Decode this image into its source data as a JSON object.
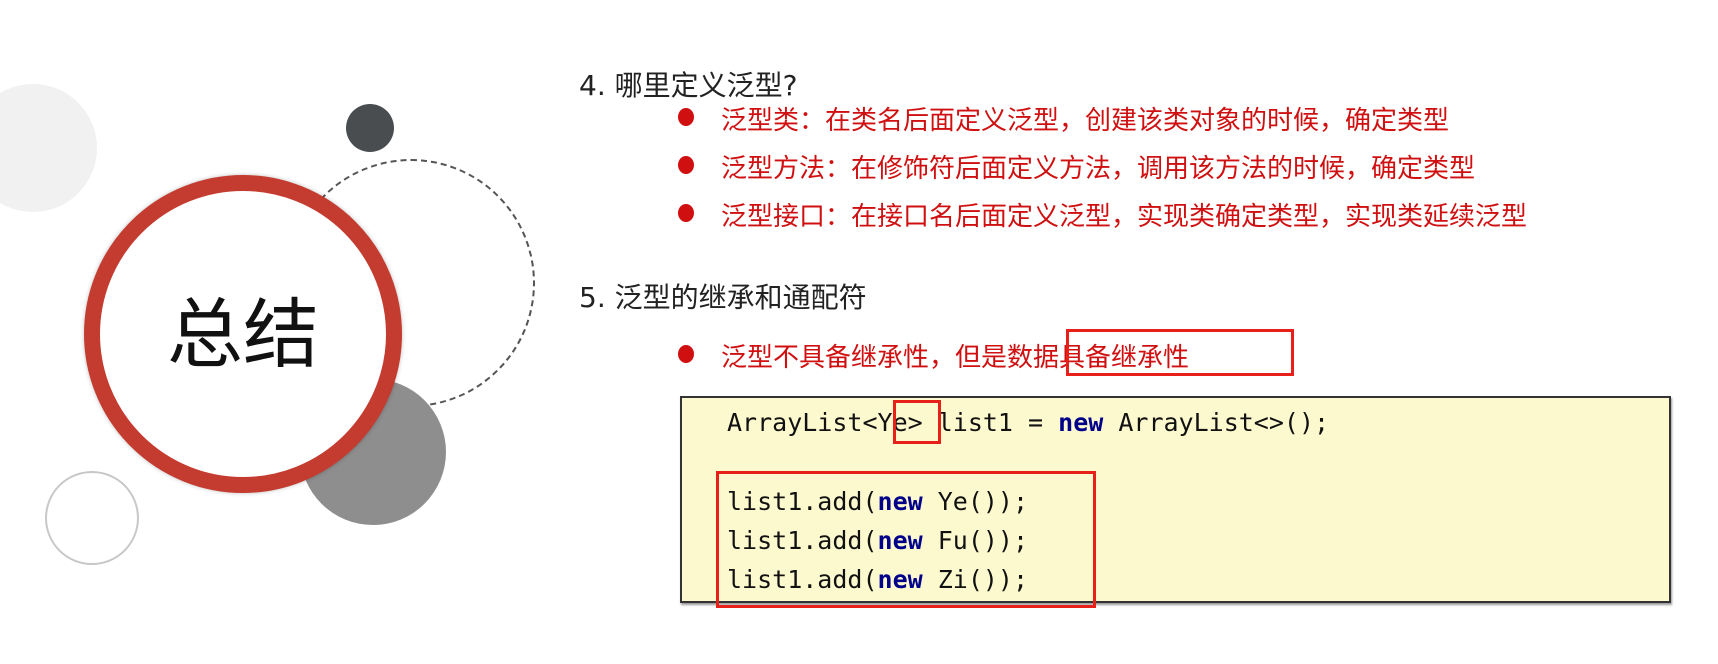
{
  "decor": {
    "title": "总结",
    "accent": "#c43b2f"
  },
  "section4": {
    "heading": "4.  哪里定义泛型?",
    "bullets": [
      "泛型类：在类名后面定义泛型，创建该类对象的时候，确定类型",
      "泛型方法：在修饰符后面定义方法，调用该方法的时候，确定类型",
      "泛型接口：在接口名后面定义泛型，实现类确定类型，实现类延续泛型"
    ]
  },
  "section5": {
    "heading": "5.  泛型的继承和通配符",
    "bullet_prefix": "泛型不具备继承性，但是",
    "bullet_highlight": "数据具备继承性"
  },
  "code": {
    "line1": {
      "a": "ArrayList<",
      "b": "Ye",
      "c": "> list1 = ",
      "kw": "new",
      "d": " ArrayList<>();"
    },
    "lines": [
      {
        "a": "list1.add(",
        "kw": "new",
        "b": " Ye());"
      },
      {
        "a": "list1.add(",
        "kw": "new",
        "b": " Fu());"
      },
      {
        "a": "list1.add(",
        "kw": "new",
        "b": " Zi());"
      }
    ]
  }
}
